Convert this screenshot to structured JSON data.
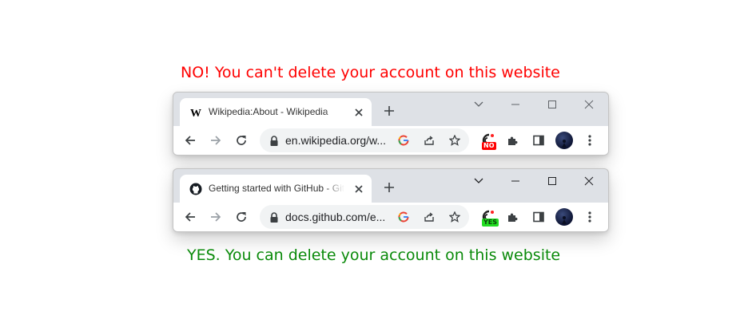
{
  "captions": {
    "no": "NO! You can't delete your account on this website",
    "yes": "YES. You can delete your account on this website"
  },
  "browsers": [
    {
      "tab_title": "Wikipedia:About - Wikipedia",
      "favicon": "wikipedia-w-icon",
      "url": "en.wikipedia.org/w...",
      "badge": "NO",
      "badge_color": "#ff0000"
    },
    {
      "tab_title": "Getting started with GitHub - GitHub Docs",
      "favicon": "github-icon",
      "url": "docs.github.com/e...",
      "badge": "YES",
      "badge_color": "#22dd22"
    }
  ],
  "colors": {
    "no_text": "#ff0000",
    "yes_text": "#0a8a0a",
    "tabstrip": "#dee1e6",
    "omnibox": "#f1f3f4"
  }
}
